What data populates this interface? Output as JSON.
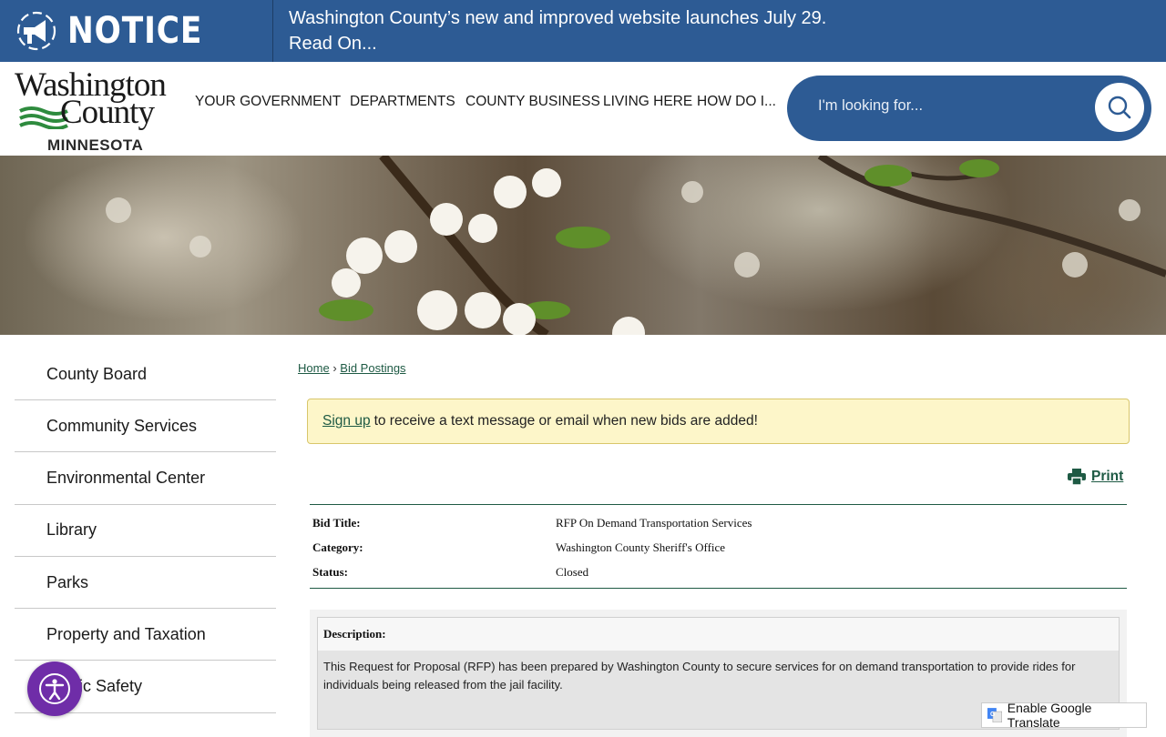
{
  "notice": {
    "label": "NOTICE",
    "line1": "Washington County’s new and improved website launches July 29.",
    "line2": "Read On..."
  },
  "logo": {
    "line1": "Washington",
    "line2": "County",
    "state": "MINNESOTA"
  },
  "nav": [
    "YOUR GOVERNMENT",
    "DEPARTMENTS",
    "COUNTY BUSINESS",
    "LIVING HERE",
    "HOW DO I..."
  ],
  "search": {
    "placeholder": "I'm looking for..."
  },
  "sidebar": {
    "items": [
      "County Board",
      "Community Services",
      "Environmental Center",
      "Library",
      "Parks",
      "Property and Taxation",
      "Public Safety"
    ]
  },
  "breadcrumb": {
    "home": "Home",
    "sep": "›",
    "current": "Bid Postings"
  },
  "signup": {
    "link": "Sign up",
    "text": "to receive a text message or email when new bids are added!"
  },
  "print": {
    "label": "Print"
  },
  "bid": {
    "rows": [
      {
        "key": "Bid Title:",
        "value": "RFP On Demand Transportation Services"
      },
      {
        "key": "Category:",
        "value": "Washington County Sheriff's Office"
      },
      {
        "key": "Status:",
        "value": "Closed"
      }
    ]
  },
  "description": {
    "heading": "Description:",
    "body": "This Request for Proposal (RFP) has been prepared by Washington County to secure services for on demand transportation to provide rides for individuals being released from the jail facility."
  },
  "translate": {
    "label": "Enable Google Translate"
  },
  "colors": {
    "brand_blue": "#2d5b94",
    "link_green": "#1e5a44",
    "accessibility_purple": "#6f2da8",
    "signup_bg": "#fdf6c9"
  }
}
